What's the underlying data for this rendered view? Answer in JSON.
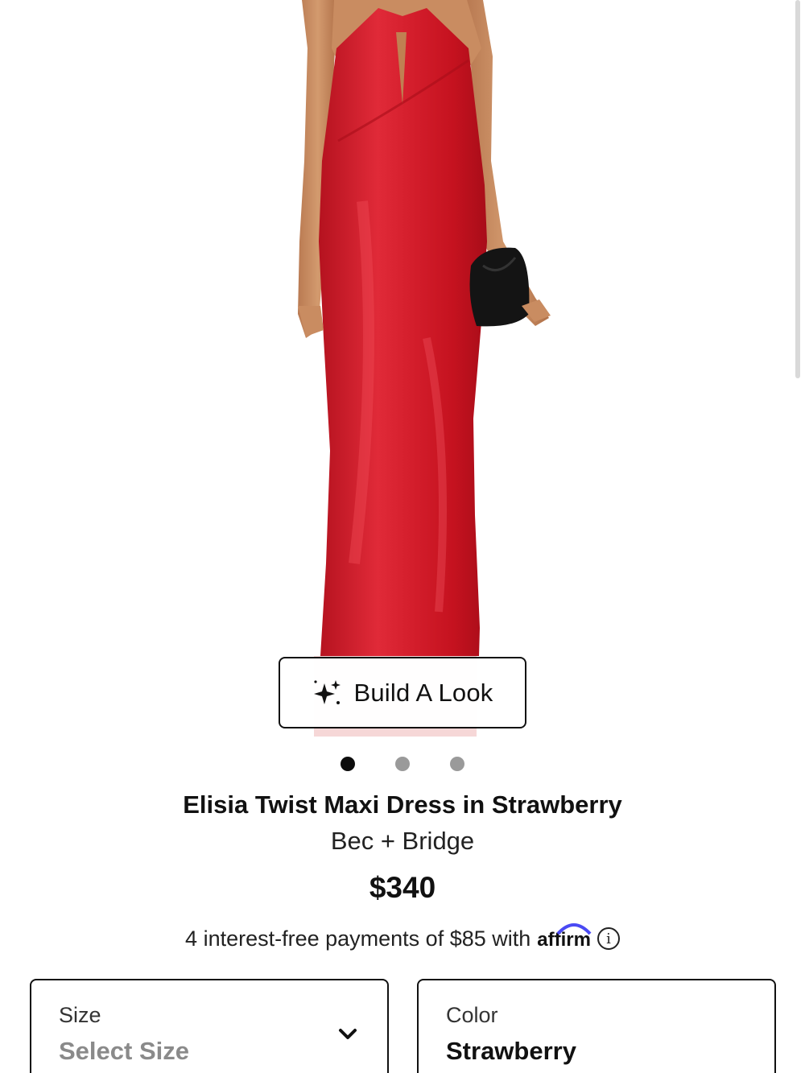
{
  "product": {
    "image_alt": "Model wearing red satin halter maxi dress holding black clutch",
    "build_look_label": "Build A Look",
    "carousel": {
      "count": 3,
      "active_index": 0
    },
    "title": "Elisia Twist Maxi Dress in Strawberry",
    "brand": "Bec + Bridge",
    "price": "$340"
  },
  "financing": {
    "text": "4 interest-free payments of $85 with",
    "provider": "affirm",
    "info_icon": "info-icon"
  },
  "options": {
    "size_label": "Size",
    "size_value": "Select Size",
    "color_label": "Color",
    "color_value": "Strawberry"
  },
  "colors": {
    "dress": "#d0202f",
    "accent_dark": "#111111",
    "muted_text": "#8a8a8a",
    "affirm_blue": "#4a4af4"
  }
}
